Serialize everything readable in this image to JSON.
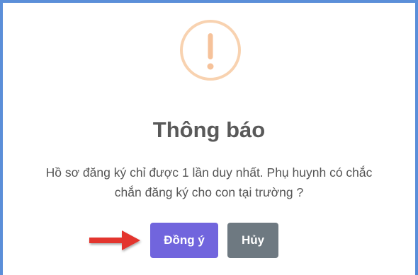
{
  "dialog": {
    "icon": "warning-exclamation-icon",
    "title": "Thông báo",
    "message": "Hồ sơ đăng ký chỉ được 1 lần duy nhất. Phụ huynh có chắc chắn đăng ký cho con tại trường ?",
    "confirm_label": "Đồng ý",
    "cancel_label": "Hủy"
  },
  "annotation": {
    "icon": "red-arrow-icon"
  },
  "colors": {
    "icon_ring": "#f8d2b0",
    "icon_mark": "#f6c29a",
    "confirm_button": "#7165dd",
    "cancel_button": "#6e7981",
    "arrow": "#e3342f",
    "frame_border": "#5b8fd9"
  }
}
